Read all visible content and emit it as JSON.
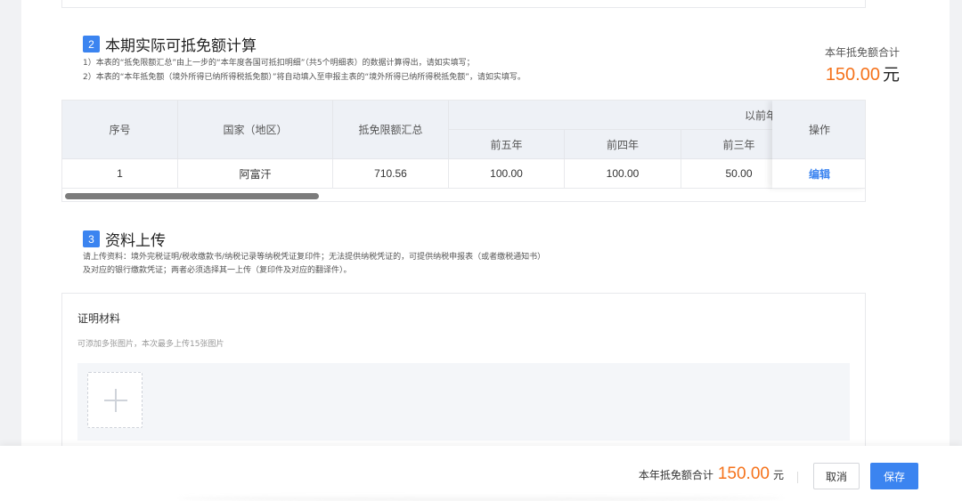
{
  "section2": {
    "number": "2",
    "title": "本期实际可抵免额计算",
    "note1": "1）本表的“抵免限额汇总”由上一步的“本年度各国可抵扣明细”（共5个明细表）的数据计算得出，请如实填写；",
    "note2": "2）本表的“本年抵免额（境外所得已纳所得税抵免额）”将自动填入至申报主表的“境外所得已纳所得税抵免额”，请如实填写。",
    "total_label": "本年抵免额合计",
    "total_value": "150.00",
    "total_unit": "元"
  },
  "table": {
    "headers": {
      "index": "序号",
      "country": "国家（地区）",
      "limit_total": "抵免限额汇总",
      "group_prev": "以前年",
      "prev5": "前五年",
      "prev4": "前四年",
      "prev3": "前三年",
      "operation": "操作"
    },
    "rows": [
      {
        "index": "1",
        "country": "阿富汗",
        "limit_total": "710.56",
        "prev5": "100.00",
        "prev4": "100.00",
        "prev3": "50.00",
        "operation": "编辑"
      }
    ]
  },
  "section3": {
    "number": "3",
    "title": "资料上传",
    "note1": "请上传资料：境外完税证明/税收缴款书/纳税记录等纳税凭证复印件；无法提供纳税凭证的，可提供纳税申报表（或者缴税通知书）",
    "note2": "及对应的银行缴款凭证；两者必须选择其一上传（复印件及对应的翻译件）。",
    "card_title": "证明材料",
    "card_hint": "可添加多张图片，本次最多上传15张图片"
  },
  "footer": {
    "total_label": "本年抵免额合计",
    "total_value": "150.00",
    "total_unit": "元",
    "cancel_label": "取消",
    "save_label": "保存"
  },
  "colors": {
    "accent": "#3b84f0",
    "highlight": "#f5721b"
  }
}
